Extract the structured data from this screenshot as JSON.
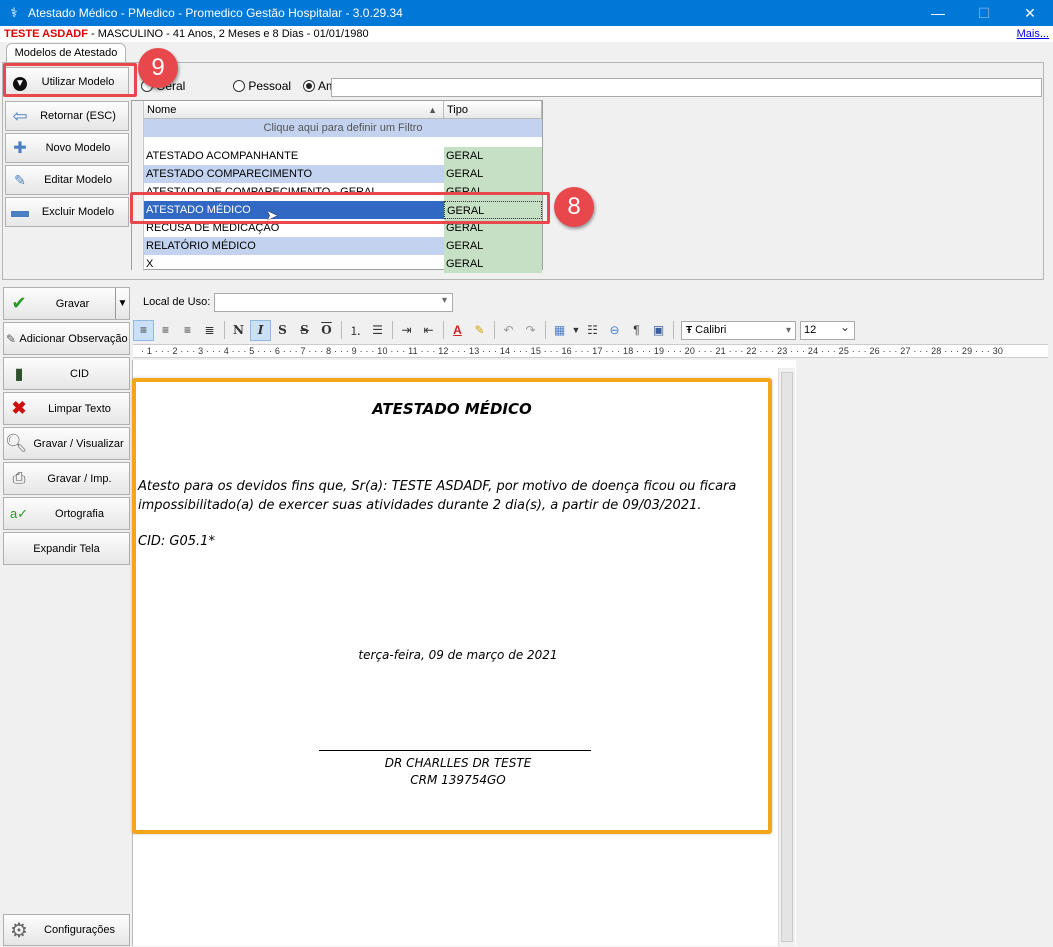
{
  "window": {
    "title": "Atestado Médico - PMedico - Promedico Gestão Hospitalar - 3.0.29.34",
    "minimize": "—",
    "maximize": "☐",
    "close": "✕"
  },
  "patient": {
    "name": "TESTE ASDADF",
    "details": " - MASCULINO - 41 Anos, 2 Meses e 8 Dias - 01/01/1980",
    "more_link": "Mais..."
  },
  "tab": {
    "label": "Modelos de Atestado"
  },
  "model_actions": [
    {
      "label": "Utilizar Modelo",
      "icon": "down-arrow-icon"
    },
    {
      "label": "Retornar (ESC)",
      "icon": "back-arrow-icon"
    },
    {
      "label": "Novo Modelo",
      "icon": "add-icon"
    },
    {
      "label": "Editar Modelo",
      "icon": "pencil-icon"
    },
    {
      "label": "Excluir Modelo",
      "icon": "minus-icon"
    }
  ],
  "filter": {
    "options": [
      "Geral",
      "Pessoal",
      "Ambos"
    ],
    "selected": "Ambos",
    "search_value": ""
  },
  "grid": {
    "columns": [
      "Nome",
      "Tipo"
    ],
    "filter_hint": "Clique aqui para definir um Filtro",
    "rows": [
      {
        "name": "ATESTADO ACOMPANHANTE",
        "type": "GERAL"
      },
      {
        "name": "ATESTADO COMPARECIMENTO",
        "type": "GERAL"
      },
      {
        "name": "ATESTADO DE COMPARECIMENTO - GERAL",
        "type": "GERAL"
      },
      {
        "name": "ATESTADO MÉDICO",
        "type": "GERAL"
      },
      {
        "name": "RECUSA DE MEDICAÇÃO",
        "type": "GERAL"
      },
      {
        "name": "RELATÓRIO MÉDICO",
        "type": "GERAL"
      },
      {
        "name": "X",
        "type": "GERAL"
      }
    ],
    "selected_row": 3
  },
  "callouts": {
    "step8": "8",
    "step9": "9"
  },
  "sidebar": [
    {
      "label": "Gravar",
      "icon": "check-icon"
    },
    {
      "label": "Adicionar Observação",
      "icon": "pencil-icon"
    },
    {
      "label": "CID",
      "icon": "book-icon"
    },
    {
      "label": "Limpar Texto",
      "icon": "red-x-icon"
    },
    {
      "label": "Gravar / Visualizar",
      "icon": "magnifier-icon"
    },
    {
      "label": "Gravar / Imp.",
      "icon": "printer-icon"
    },
    {
      "label": "Ortografia",
      "icon": "spellcheck-icon"
    },
    {
      "label": "Expandir Tela",
      "icon": ""
    },
    {
      "label": "Configurações",
      "icon": "gear-icon"
    }
  ],
  "local_uso": {
    "label": "Local de Uso:",
    "value": ""
  },
  "toolbar": {
    "font": "Calibri",
    "size": "12"
  },
  "ruler": "· 1 · · · 2 · · · 3 · · · 4 · · · 5 · · · 6 · · · 7 · · · 8 · · · 9 · · · 10 · · · 11 · · · 12 · · · 13 · · · 14 · · · 15 · · · 16 · · · 17 · · · 18 · · · 19 · · · 20 · · · 21 · · · 22 · · · 23 · · · 24 · · · 25 · · · 26 · · · 27 · · · 28 · · · 29 · · · 30",
  "document": {
    "title": "ATESTADO MÉDICO",
    "body": "Atesto para os devidos fins que, Sr(a): TESTE ASDADF, por motivo de doença ficou ou ficara impossibilitado(a) de exercer suas atividades durante 2 dia(s), a partir de 09/03/2021.",
    "cid": "CID: G05.1*",
    "date": "terça-feira, 09 de março de 2021",
    "doctor": "DR  CHARLLES DR TESTE",
    "crm": "CRM 139754GO"
  },
  "colors": {
    "titlebar": "#0078d7",
    "callout": "#e8474b",
    "page_border": "#f2a71b",
    "selected_row": "#3168c4"
  }
}
